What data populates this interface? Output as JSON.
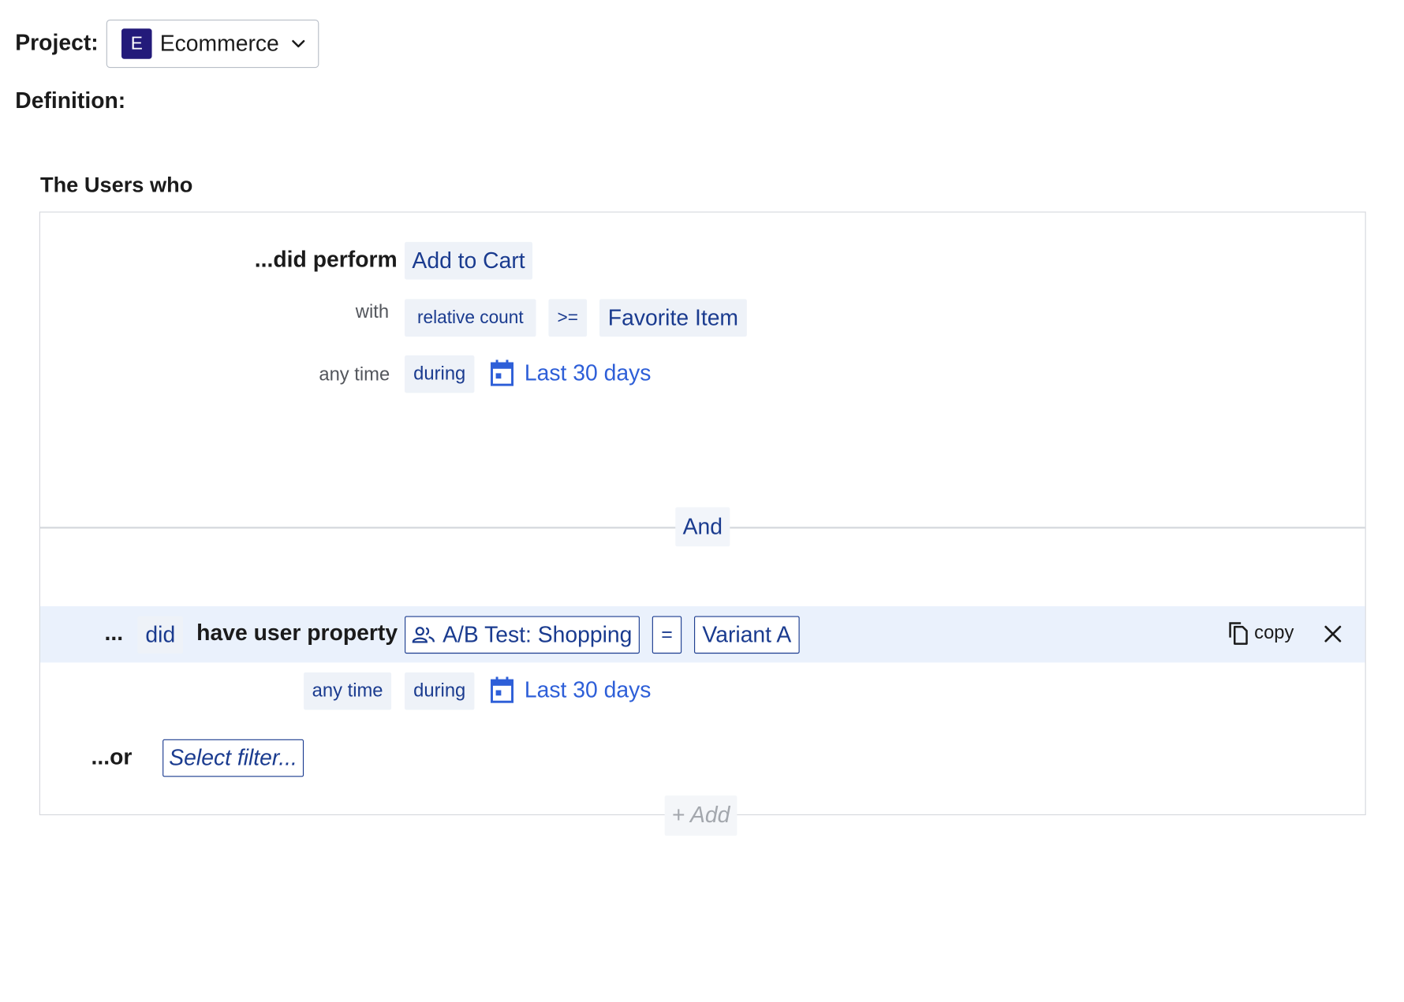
{
  "header": {
    "project_label": "Project:",
    "project_badge": "E",
    "project_name": "Ecommerce",
    "definition_label": "Definition:"
  },
  "segment": {
    "title": "The Users who",
    "group1": {
      "did_perform_label": "...did perform",
      "event": "Add to Cart",
      "with_label": "with",
      "metric": "relative count",
      "operator": ">=",
      "value": "Favorite Item",
      "time_label": "any time",
      "during_label": "during",
      "date_range": "Last 30 days"
    },
    "join_label": "And",
    "group2": {
      "ellipsis": "...",
      "did_label": "did",
      "have_prop_label": "have user property",
      "property": "A/B Test: Shopping",
      "operator": "=",
      "value": "Variant A",
      "copy_label": "copy",
      "time_label": "any time",
      "during_label": "during",
      "date_range": "Last 30 days"
    },
    "or_label": "...or",
    "filter_placeholder": "Select filter...",
    "add_label": "+ Add"
  },
  "colors": {
    "accent": "#2e5fd8",
    "chip_text": "#1a3b8f",
    "chip_bg": "#eef2f8",
    "highlight_row": "#eaf1fc",
    "badge": "#231a7a"
  }
}
